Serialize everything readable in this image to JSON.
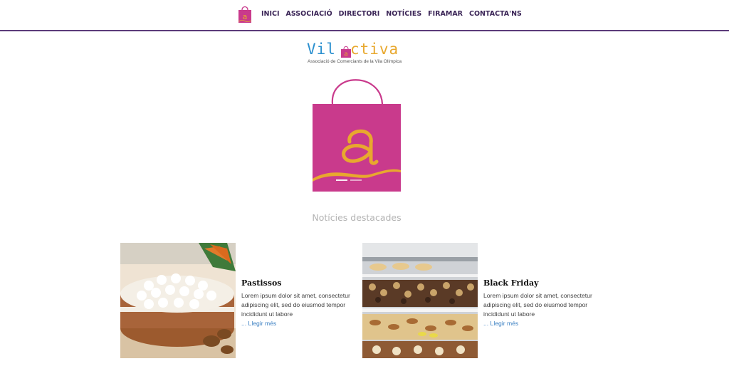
{
  "nav": {
    "logo_icon": "shopping-bag-a-icon",
    "items": [
      "INICI",
      "ASSOCIACIÓ",
      "DIRECTORI",
      "NOTÍCIES",
      "FIRAMAR",
      "CONTACTA'NS"
    ]
  },
  "brand": {
    "vil": "Vil",
    "activa": "ctiva",
    "subtitle": "Associació de Comerciants de la Vila Olímpica"
  },
  "hero": {
    "image": "shopping-bag-a-logo",
    "slides": 2,
    "active_slide": 1
  },
  "section": {
    "title": "Notícies destacades"
  },
  "news": [
    {
      "title": "Pastissos",
      "text": "Lorem ipsum dolor sit amet, consectetur adipiscing elit, sed do eiusmod tempor incididunt ut labore",
      "more": "... Llegir més",
      "image": "carrot-cake-photo"
    },
    {
      "title": "Black Friday",
      "text": "Lorem ipsum dolor sit amet, consectetur adipiscing elit, sed do eiusmod tempor incididunt ut labore",
      "more": "... Llegir més",
      "image": "pastry-display-case-photo"
    }
  ],
  "colors": {
    "nav_text": "#3a2456",
    "nav_border": "#5b3b7a",
    "brand_blue": "#2a8fcf",
    "brand_orange": "#e8a82e",
    "bag_magenta": "#c93a8c",
    "link_blue": "#3a7fc2"
  }
}
